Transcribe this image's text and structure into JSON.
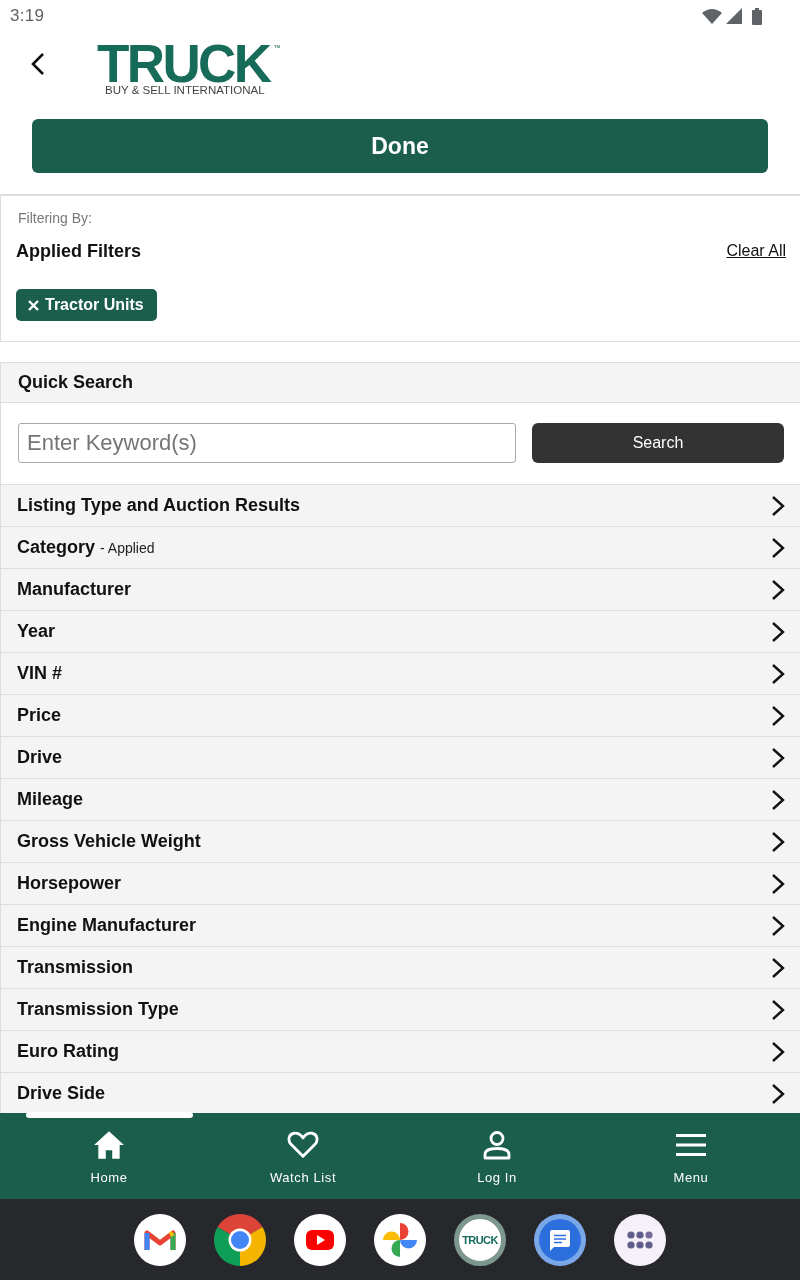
{
  "status_bar": {
    "time": "3:19"
  },
  "header": {
    "logo": {
      "wordmark": "TRUCK",
      "trademark": "™",
      "tagline": "BUY & SELL INTERNATIONAL"
    }
  },
  "done_button": {
    "label": "Done"
  },
  "applied_filters": {
    "caption": "Filtering By:",
    "title": "Applied Filters",
    "clear_link": "Clear All",
    "chips": [
      {
        "label": "Tractor Units"
      }
    ]
  },
  "quick_search": {
    "title": "Quick Search",
    "search_field": {
      "placeholder": "Enter Keyword(s)"
    },
    "search_button": "Search"
  },
  "filter_sections": [
    {
      "label": "Listing Type and Auction Results"
    },
    {
      "label": "Category",
      "note": "- Applied"
    },
    {
      "label": "Manufacturer"
    },
    {
      "label": "Year"
    },
    {
      "label": "VIN #"
    },
    {
      "label": "Price"
    },
    {
      "label": "Drive"
    },
    {
      "label": "Mileage"
    },
    {
      "label": "Gross Vehicle Weight"
    },
    {
      "label": "Horsepower"
    },
    {
      "label": "Engine Manufacturer"
    },
    {
      "label": "Transmission"
    },
    {
      "label": "Transmission Type"
    },
    {
      "label": "Euro Rating"
    },
    {
      "label": "Drive Side"
    }
  ],
  "bottom_nav": {
    "items": [
      {
        "label": "Home"
      },
      {
        "label": "Watch List"
      },
      {
        "label": "Log In"
      },
      {
        "label": "Menu"
      }
    ]
  },
  "dock": {
    "app_text": "TRUCK"
  }
}
